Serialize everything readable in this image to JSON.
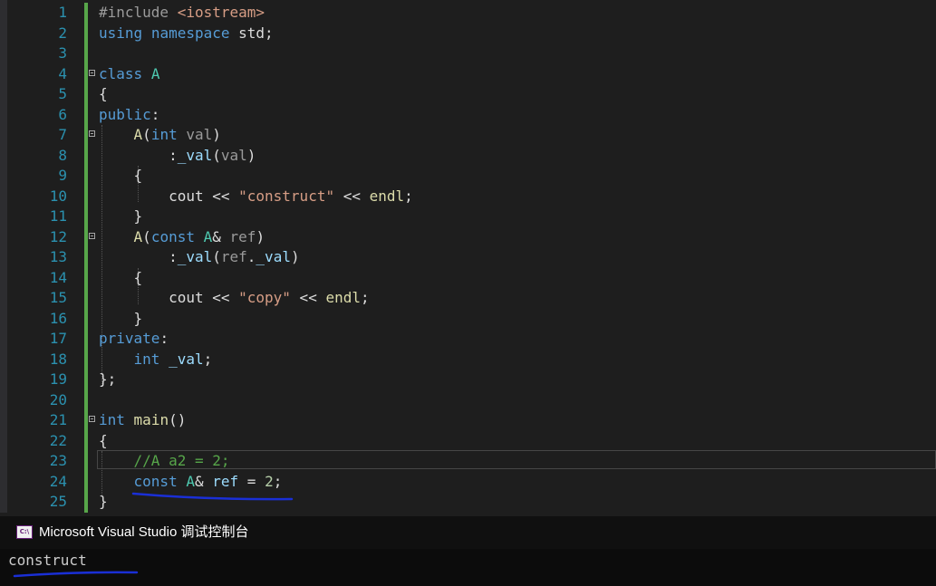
{
  "editor": {
    "lines": [
      {
        "n": "1",
        "t": "#include <iostream>"
      },
      {
        "n": "2",
        "t": "using namespace std;"
      },
      {
        "n": "3",
        "t": ""
      },
      {
        "n": "4",
        "t": "class A"
      },
      {
        "n": "5",
        "t": "{"
      },
      {
        "n": "6",
        "t": "public:"
      },
      {
        "n": "7",
        "t": "    A(int val)"
      },
      {
        "n": "8",
        "t": "        :_val(val)"
      },
      {
        "n": "9",
        "t": "    {"
      },
      {
        "n": "10",
        "t": "        cout << \"construct\" << endl;"
      },
      {
        "n": "11",
        "t": "    }"
      },
      {
        "n": "12",
        "t": "    A(const A& ref)"
      },
      {
        "n": "13",
        "t": "        :_val(ref._val)"
      },
      {
        "n": "14",
        "t": "    {"
      },
      {
        "n": "15",
        "t": "        cout << \"copy\" << endl;"
      },
      {
        "n": "16",
        "t": "    }"
      },
      {
        "n": "17",
        "t": "private:"
      },
      {
        "n": "18",
        "t": "    int _val;"
      },
      {
        "n": "19",
        "t": "};"
      },
      {
        "n": "20",
        "t": ""
      },
      {
        "n": "21",
        "t": "int main()"
      },
      {
        "n": "22",
        "t": "{"
      },
      {
        "n": "23",
        "t": "    //A a2 = 2;"
      },
      {
        "n": "24",
        "t": "    const A& ref = 2;"
      },
      {
        "n": "25",
        "t": "}"
      }
    ],
    "fold_lines": [
      "4",
      "7",
      "12",
      "21"
    ],
    "current_line": "23"
  },
  "console": {
    "icon": "console-app-icon",
    "icon_text": "C:\\",
    "title": "Microsoft Visual Studio 调试控制台",
    "output": "construct"
  },
  "colors": {
    "keyword": "#569cd6",
    "type": "#4ec9b0",
    "function": "#dcdcaa",
    "string": "#d69d85",
    "comment": "#57a64a",
    "line_number": "#2b91af",
    "annotation_ink": "#1a2fd6"
  }
}
